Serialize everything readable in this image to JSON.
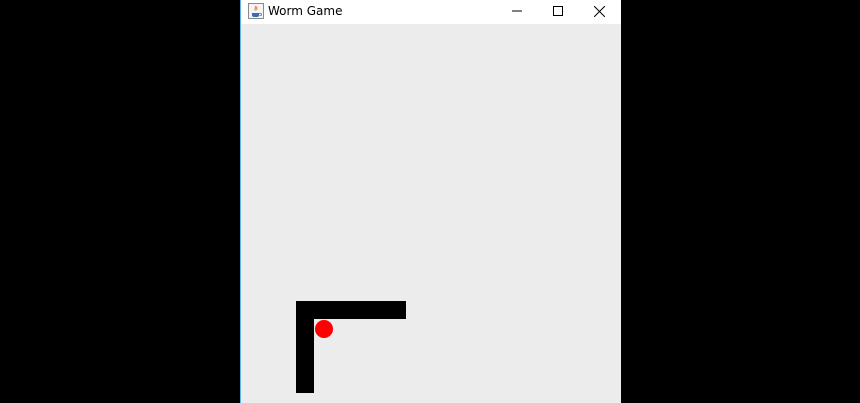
{
  "window": {
    "title": "Worm Game",
    "icon": "java-icon",
    "controls": [
      "minimize-icon",
      "maximize-icon",
      "close-icon"
    ]
  },
  "game": {
    "worm_color": "#000000",
    "apple_color": "#ff0000",
    "background_color": "#ececec"
  }
}
